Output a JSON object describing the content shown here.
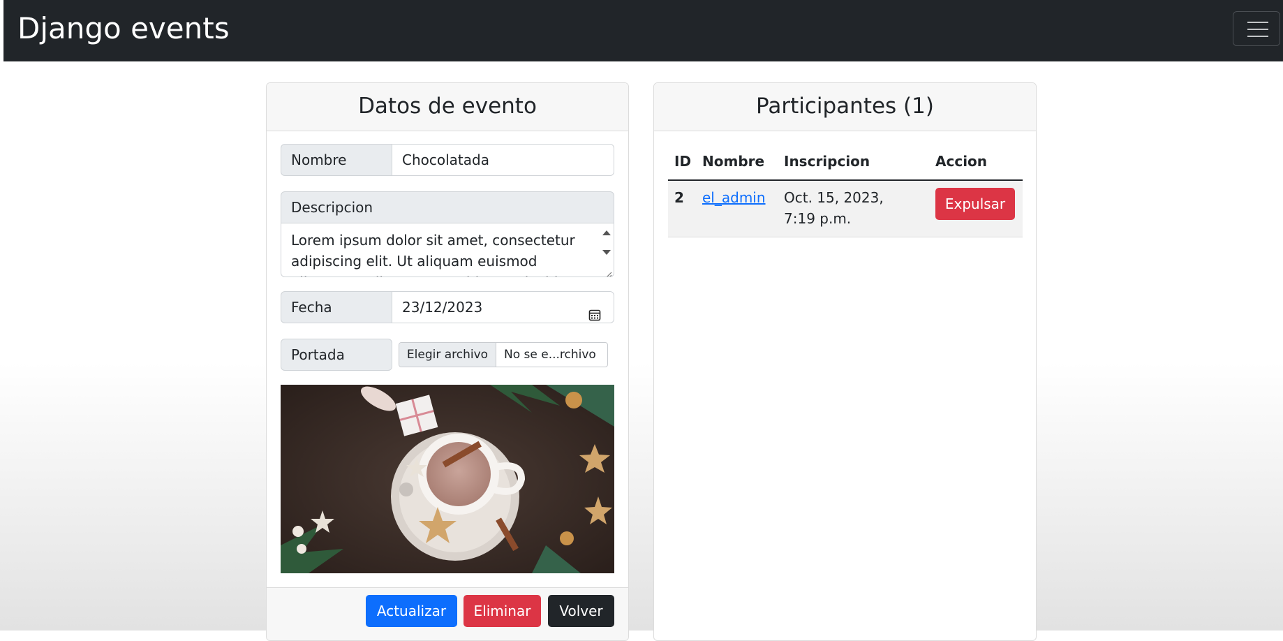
{
  "navbar": {
    "brand": "Django events",
    "toggler_icon": "hamburger-icon"
  },
  "event_card": {
    "title": "Datos de evento",
    "fields": {
      "nombre": {
        "label": "Nombre",
        "value": "Chocolatada"
      },
      "descripcion": {
        "label": "Descripcion",
        "value": "Lorem ipsum dolor sit amet, consectetur adipiscing elit. Ut aliquam euismod aliquam. Nullam non est id ante tincidunt"
      },
      "fecha": {
        "label": "Fecha",
        "value": "23/12/2023",
        "icon": "calendar-icon"
      },
      "portada": {
        "label": "Portada",
        "choose_button": "Elegir archivo",
        "file_status": "No se e...rchivo"
      }
    },
    "image_alt": "cover-image-hot-chocolate",
    "buttons": {
      "update": "Actualizar",
      "delete": "Eliminar",
      "back": "Volver"
    }
  },
  "participants_card": {
    "title": "Participantes (1)",
    "table": {
      "headers": [
        "ID",
        "Nombre",
        "Inscripcion",
        "Accion"
      ],
      "rows": [
        {
          "id": "2",
          "name": "el_admin",
          "date": "Oct. 15, 2023, 7:19 p.m.",
          "action": "Expulsar"
        }
      ]
    }
  },
  "colors": {
    "navbar": "#212529",
    "primary": "#0d6efd",
    "danger": "#dc3545",
    "dark": "#212529",
    "link": "#0d6efd"
  }
}
